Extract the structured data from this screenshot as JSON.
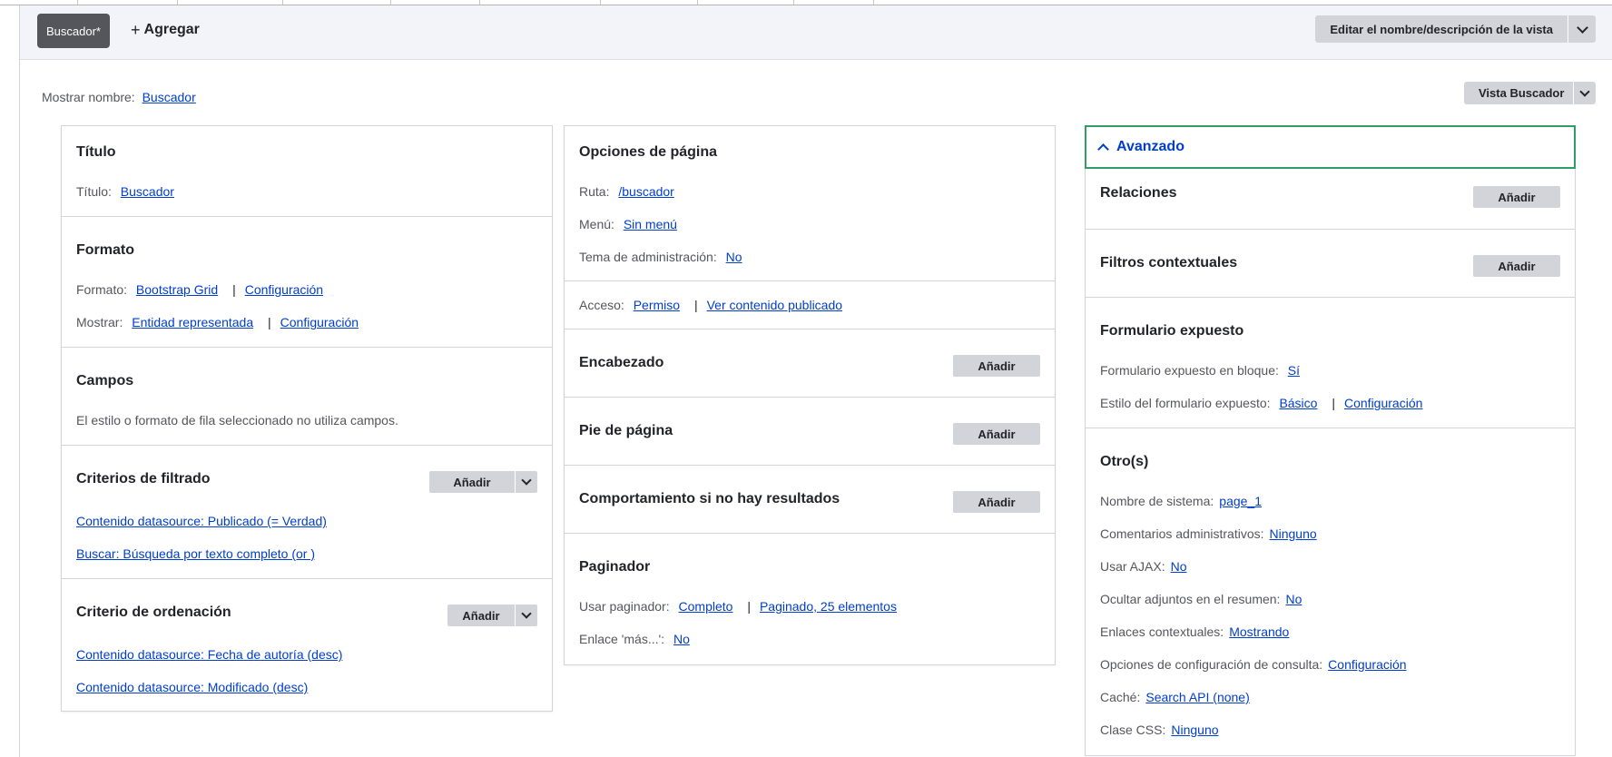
{
  "tabs": {
    "active_label": "Buscador*",
    "add_label": "Agregar",
    "add_symbol": "+",
    "edit_name_label": "Editar el nombre/descripción de la vista"
  },
  "display": {
    "name_label": "Mostrar nombre:",
    "name_value": "Buscador",
    "view_button_label": "Vista Buscador"
  },
  "col1": {
    "titulo": {
      "heading": "Título",
      "label": "Título:",
      "value": "Buscador"
    },
    "formato": {
      "heading": "Formato",
      "format_label": "Formato:",
      "format_value": "Bootstrap Grid",
      "format_config": "Configuración",
      "show_label": "Mostrar:",
      "show_value": "Entidad representada",
      "show_config": "Configuración",
      "separator": "|"
    },
    "campos": {
      "heading": "Campos",
      "text": "El estilo o formato de fila seleccionado no utiliza campos."
    },
    "filtros": {
      "heading": "Criterios de filtrado",
      "add_label": "Añadir",
      "items": [
        "Contenido datasource: Publicado (= Verdad)",
        "Buscar: Búsqueda por texto completo (or )"
      ]
    },
    "orden": {
      "heading": "Criterio de ordenación",
      "add_label": "Añadir",
      "items": [
        "Contenido datasource: Fecha de autoría (desc)",
        "Contenido datasource: Modificado (desc)"
      ]
    }
  },
  "col2": {
    "pagina": {
      "heading": "Opciones de página",
      "ruta_label": "Ruta:",
      "ruta_value": "/buscador",
      "menu_label": "Menú:",
      "menu_value": "Sin menú",
      "tema_label": "Tema de administración:",
      "tema_value": "No"
    },
    "acceso": {
      "label": "Acceso:",
      "value": "Permiso",
      "value2": "Ver contenido publicado",
      "separator": "|"
    },
    "encabezado": {
      "heading": "Encabezado",
      "add_label": "Añadir"
    },
    "pie": {
      "heading": "Pie de página",
      "add_label": "Añadir"
    },
    "sinres": {
      "heading": "Comportamiento si no hay resultados",
      "add_label": "Añadir"
    },
    "paginador": {
      "heading": "Paginador",
      "usar_label": "Usar paginador:",
      "usar_value": "Completo",
      "usar_value2": "Paginado, 25 elementos",
      "mas_label": "Enlace 'más...':",
      "mas_value": "No",
      "separator": "|"
    }
  },
  "col3": {
    "advanced_label": "Avanzado",
    "relaciones": {
      "heading": "Relaciones",
      "add_label": "Añadir"
    },
    "contextuales": {
      "heading": "Filtros contextuales",
      "add_label": "Añadir"
    },
    "expuesto": {
      "heading": "Formulario expuesto",
      "bloque_label": "Formulario expuesto en bloque:",
      "bloque_value": "Sí",
      "estilo_label": "Estilo del formulario expuesto:",
      "estilo_value": "Básico",
      "estilo_config": "Configuración",
      "separator": "|"
    },
    "otros": {
      "heading": "Otro(s)",
      "rows": [
        {
          "label": "Nombre de sistema:",
          "value": "page_1"
        },
        {
          "label": "Comentarios administrativos:",
          "value": "Ninguno"
        },
        {
          "label": "Usar AJAX:",
          "value": "No"
        },
        {
          "label": "Ocultar adjuntos en el resumen:",
          "value": "No"
        },
        {
          "label": "Enlaces contextuales:",
          "value": "Mostrando"
        },
        {
          "label": "Opciones de configuración de consulta:",
          "value": "Configuración"
        },
        {
          "label": "Caché:",
          "value": "Search API (none)"
        },
        {
          "label": "Clase CSS:",
          "value": "Ninguno"
        }
      ]
    }
  },
  "colors": {
    "link": "#003ecc",
    "accent_border": "#2f9e64",
    "active_tab": "#55565b",
    "button_bg": "#d3d4d9"
  }
}
